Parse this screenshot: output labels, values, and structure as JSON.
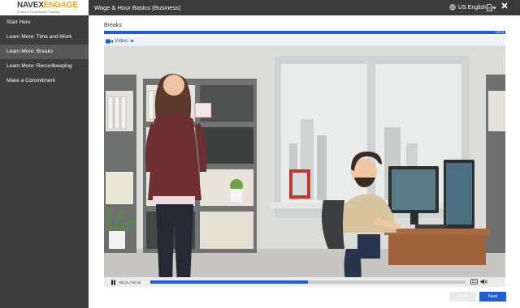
{
  "header": {
    "logo_main_a": "NAVEX",
    "logo_main_b": "ENGAGE",
    "logo_sub": "Ethics & Compliance Training",
    "course_title": "Wage & Hour Basics (Business)",
    "language": "US English"
  },
  "sidebar": {
    "items": [
      {
        "label": "Start Here",
        "active": false
      },
      {
        "label": "Learn More: Time and Work",
        "active": false
      },
      {
        "label": "Learn More: Breaks",
        "active": true
      },
      {
        "label": "Learn More: Recordkeeping",
        "active": false
      },
      {
        "label": "Make a Commitment",
        "active": false
      }
    ]
  },
  "main": {
    "section_title": "Breaks",
    "progress_percent": 100,
    "progress_label": "100%",
    "media_tab": "Video",
    "player": {
      "time": "00:21 / 00:42",
      "played_fraction": 0.5
    },
    "buttons": {
      "back": "Back",
      "next": "Next"
    }
  },
  "colors": {
    "accent": "#1e5fd6",
    "topbar": "#3a3a3a",
    "sidebar": "#3d3d3d",
    "sidebar_active": "#575757",
    "logo_accent": "#f1a21b"
  }
}
